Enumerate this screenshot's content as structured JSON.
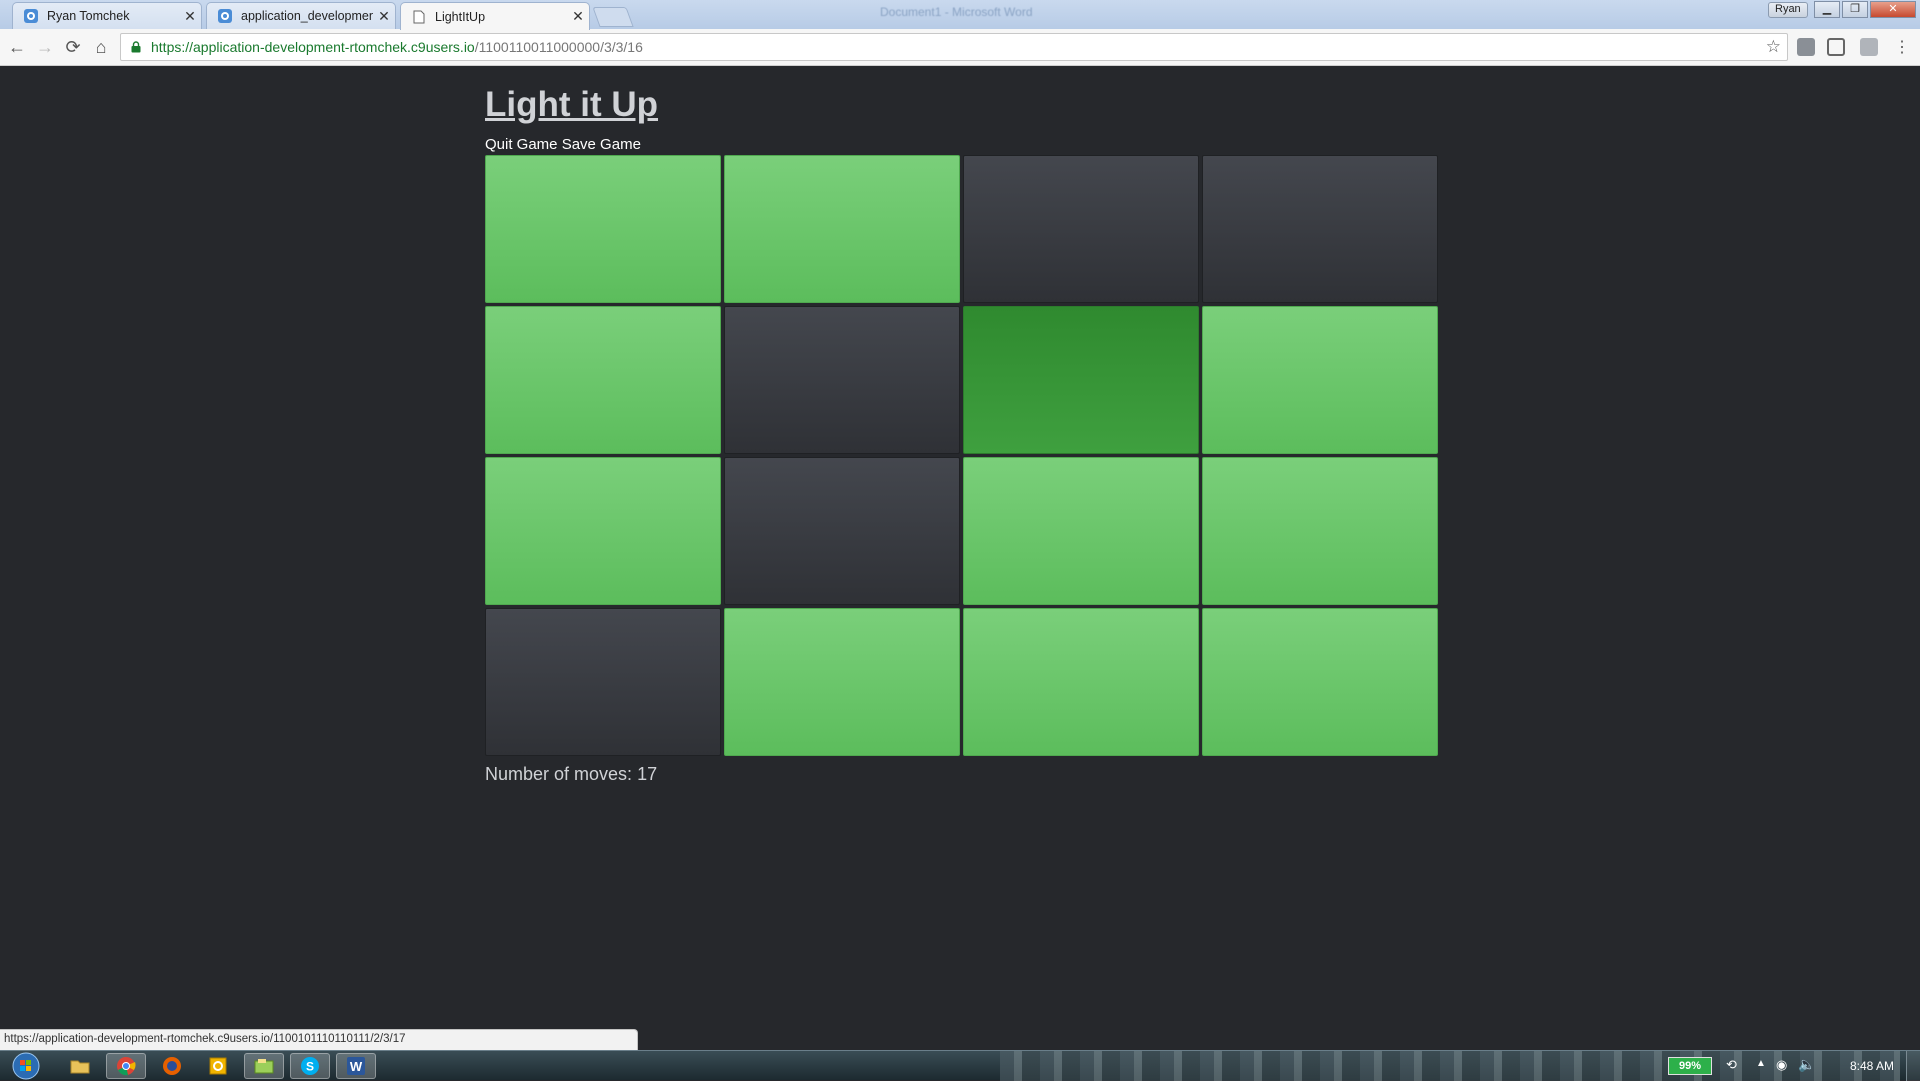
{
  "browser": {
    "tabs": [
      {
        "title": "Ryan Tomchek",
        "icon": "cloud9-icon",
        "active": false
      },
      {
        "title": "application_developmen",
        "icon": "cloud9-icon",
        "active": false
      },
      {
        "title": "LightItUp",
        "icon": "page-icon",
        "active": true
      }
    ],
    "background_window_title": "Document1 - Microsoft Word",
    "profile_name": "Ryan",
    "address": {
      "host": "https://application-development-rtomchek.c9users.io",
      "path": "/1100110011000000/3/3/16"
    },
    "status_url": "https://application-development-rtomchek.c9users.io/1100101110110111/2/3/17"
  },
  "game": {
    "title": "Light it Up",
    "quit_label": "Quit Game",
    "save_label": "Save Game",
    "moves_label": "Number of moves: ",
    "moves": "17",
    "grid_size": 4,
    "grid": [
      [
        "on",
        "on",
        "off",
        "off"
      ],
      [
        "on",
        "off",
        "highlighted",
        "on"
      ],
      [
        "on",
        "off",
        "on",
        "on"
      ],
      [
        "off",
        "on",
        "on",
        "on"
      ]
    ],
    "colors": {
      "on": "#5cbd5c",
      "off": "#3a3d43",
      "highlighted": "#3a993a",
      "background": "#26282c"
    }
  },
  "taskbar": {
    "apps": [
      "windows-explorer-icon",
      "chrome-icon",
      "firefox-icon",
      "outlook-icon",
      "file-manager-icon",
      "skype-icon",
      "word-icon"
    ],
    "battery": "99%",
    "clock": "8:48 AM"
  }
}
